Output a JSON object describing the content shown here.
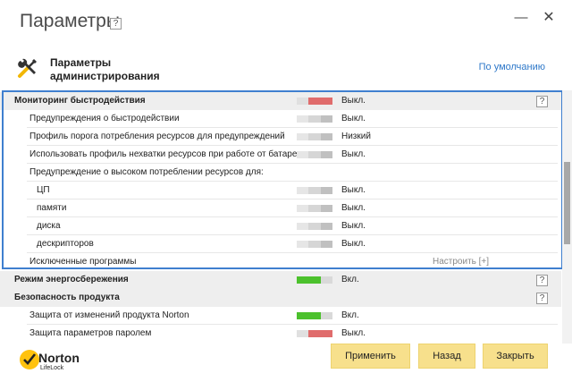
{
  "window": {
    "title": "Параметры",
    "help": "?",
    "minimize_glyph": "—",
    "close_glyph": "✕"
  },
  "header": {
    "icon": "wrench-screwdriver-icon",
    "title": "Параметры администрирования",
    "defaults_link": "По умолчанию"
  },
  "rows": [
    {
      "label": "Мониторинг быстродействия",
      "value": "Выкл.",
      "toggle": "off-red",
      "help": "?"
    },
    {
      "label": "Предупреждения о быстродействии",
      "value": "Выкл.",
      "toggle": "off"
    },
    {
      "label": "Профиль порога потребления ресурсов для предупреждений",
      "value": "Низкий",
      "toggle": "off"
    },
    {
      "label": "Использовать профиль нехватки ресурсов при работе от батареи",
      "value": "Выкл.",
      "toggle": "off"
    },
    {
      "label": "Предупреждение о высоком потреблении ресурсов для:"
    },
    {
      "label": "ЦП",
      "value": "Выкл.",
      "toggle": "off"
    },
    {
      "label": "памяти",
      "value": "Выкл.",
      "toggle": "off"
    },
    {
      "label": "диска",
      "value": "Выкл.",
      "toggle": "off"
    },
    {
      "label": "дескрипторов",
      "value": "Выкл.",
      "toggle": "off"
    },
    {
      "label": "Исключенные программы",
      "configure": "Настроить [+]"
    },
    {
      "label": "Режим энергосбережения",
      "value": "Вкл.",
      "toggle": "on",
      "help": "?"
    },
    {
      "label": "Безопасность продукта",
      "help": "?"
    },
    {
      "label": "Защита от изменений продукта Norton",
      "value": "Вкл.",
      "toggle": "on"
    },
    {
      "label": "Защита параметров паролем",
      "value": "Выкл.",
      "toggle": "off-red"
    }
  ],
  "footer": {
    "brand": "Norton",
    "brand_sub": "LifeLock",
    "apply": "Применить",
    "back": "Назад",
    "close": "Закрыть"
  },
  "colors": {
    "accent_blue": "#3f7fcf",
    "toggle_on": "#4cc12d",
    "toggle_off_red": "#e06c6c",
    "button_yellow": "#f7e08c",
    "link": "#2e78c9"
  }
}
